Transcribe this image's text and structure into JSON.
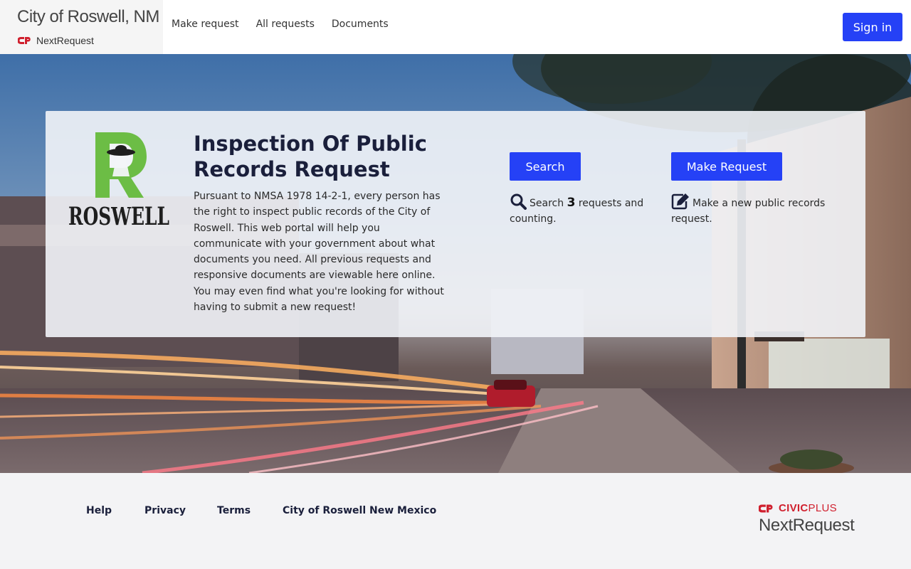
{
  "header": {
    "city_title": "City of Roswell, NM",
    "product_name": "NextRequest",
    "nav": [
      "Make request",
      "All requests",
      "Documents"
    ],
    "signin_label": "Sign in"
  },
  "hero": {
    "logo_text": "ROSWELL",
    "title": "Inspection Of Public Records Request",
    "description": "Pursuant to NMSA 1978 14-2-1, every person has the right to inspect public records of the City of Roswell. This web portal will help you communicate with your government about what documents you need. All previous requests and responsive documents are viewable here online. You may even find what you're looking for without having to submit a new request!",
    "search_button": "Search",
    "search_help_prefix": "Search",
    "request_count": "3",
    "search_help_suffix": "requests and counting.",
    "make_button": "Make Request",
    "make_help": "Make a new public records request."
  },
  "footer": {
    "links": [
      "Help",
      "Privacy",
      "Terms",
      "City of Roswell New Mexico"
    ],
    "brand_civic": "CIVIC",
    "brand_plus": "PLUS",
    "brand_product": "NextRequest"
  },
  "colors": {
    "primary": "#2541f6",
    "civicplus_red": "#d0202e",
    "logo_green": "#6cbd45"
  }
}
